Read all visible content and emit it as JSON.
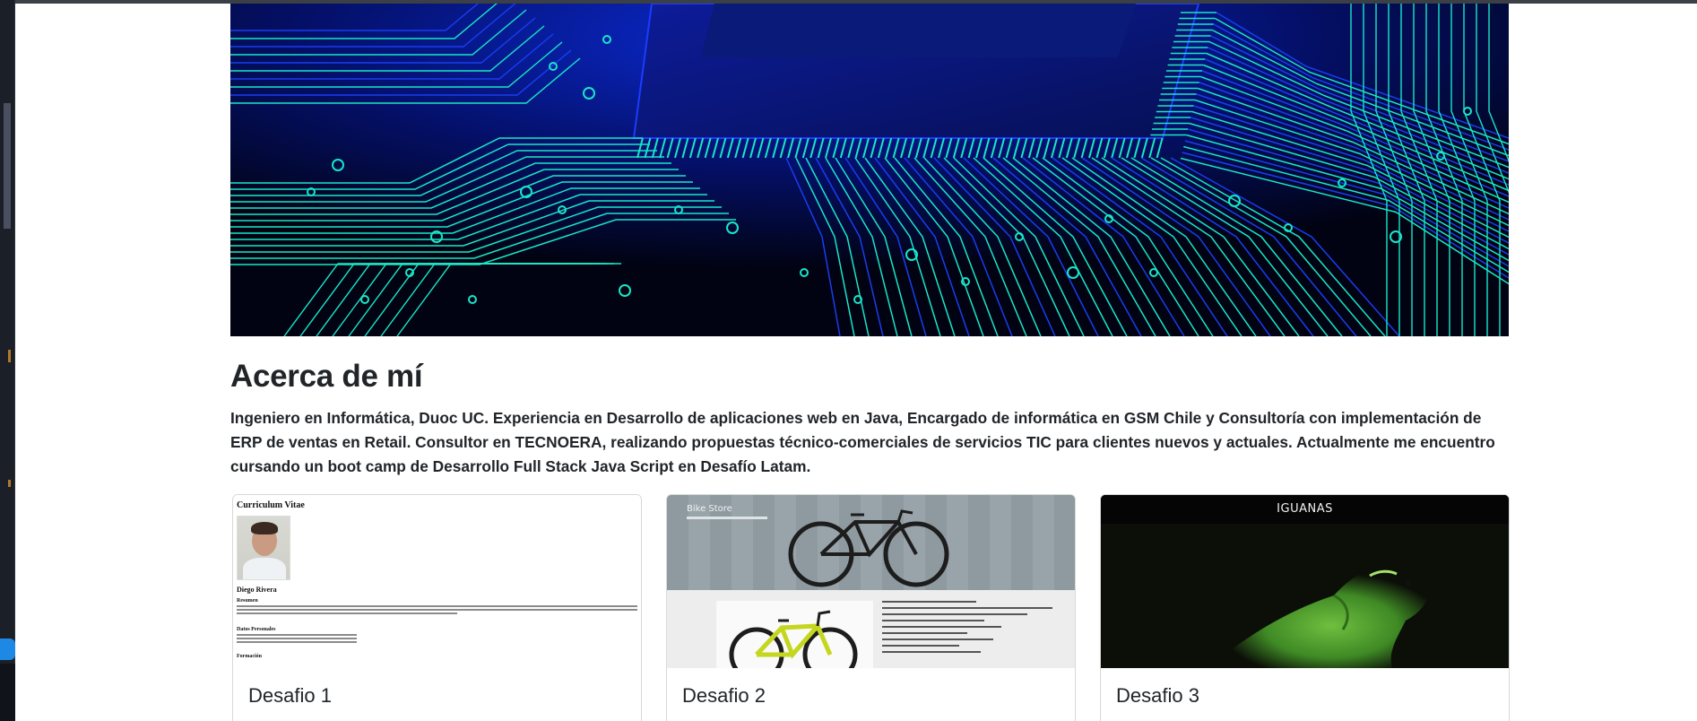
{
  "about": {
    "title": "Acerca de mí",
    "text": "Ingeniero en Informática, Duoc UC. Experiencia en Desarrollo de aplicaciones web en Java, Encargado de informática en GSM Chile y Consultoría con implementación de ERP de ventas en Retail. Consultor en TECNOERA, realizando propuestas técnico-comerciales de servicios TIC para clientes nuevos y actuales. Actualmente me encuentro cursando un boot camp de Desarrollo Full Stack Java Script en Desafío Latam."
  },
  "cards": [
    {
      "title": "Desafio 1",
      "image": {
        "heading": "Curriculum Vitae",
        "name": "Diego Rivera",
        "section_resumen": "Resumen",
        "section_datos": "Datos Personales",
        "section_formacion": "Formación"
      }
    },
    {
      "title": "Desafio 2",
      "image": {
        "brand": "Bike Store"
      }
    },
    {
      "title": "Desafio 3",
      "image": {
        "caption": "IGUANAS"
      }
    }
  ],
  "colors": {
    "hero_bg": "#02051a",
    "circuit_cyan": "#19e6c8",
    "circuit_blue": "#1a3df0",
    "iguana_green": "#5fae3a"
  }
}
